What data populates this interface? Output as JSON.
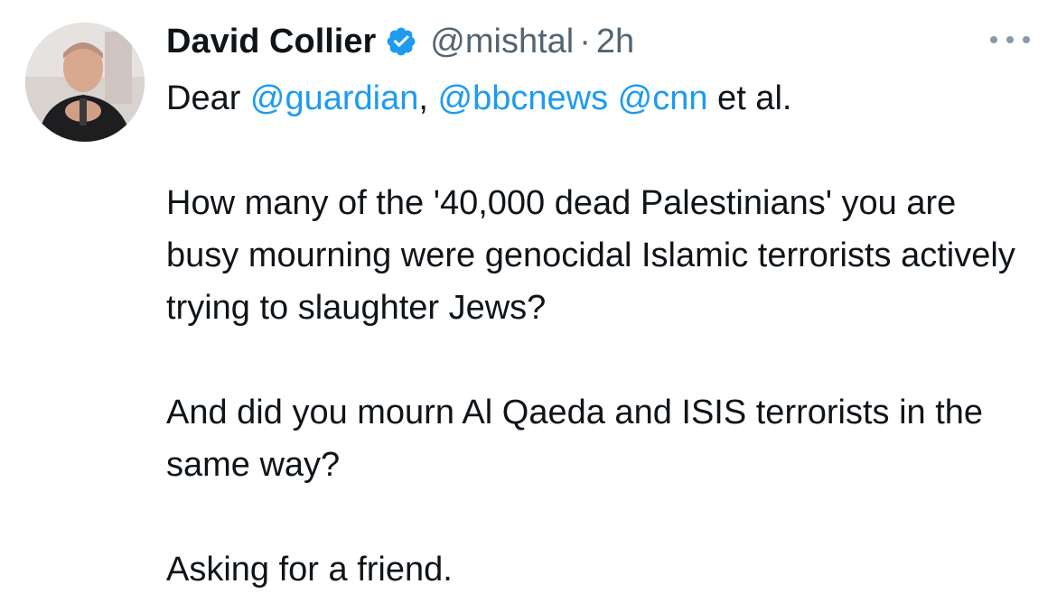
{
  "author": {
    "display_name": "David Collier",
    "handle": "@mishtal",
    "separator": "·",
    "time": "2h",
    "verified_icon": "verified-badge-icon",
    "avatar_icon": "profile-photo"
  },
  "more_icon": "more-options-icon",
  "tweet": {
    "greeting_prefix": "Dear ",
    "mention_1": "@guardian",
    "comma": ",",
    "mention_2": "@bbcnews",
    "mention_3": "@cnn",
    "greeting_suffix": " et al.",
    "paragraph_2": "How many of the '40,000 dead Palestinians' you are busy mourning were genocidal Islamic terrorists actively trying to slaughter Jews?",
    "paragraph_3": "And did you mourn Al Qaeda and ISIS terrorists in the same way?",
    "paragraph_4": "Asking for a friend."
  },
  "colors": {
    "text": "#0f1419",
    "secondary": "#536471",
    "link": "#1d9bf0",
    "verified": "#1d9bf0"
  }
}
